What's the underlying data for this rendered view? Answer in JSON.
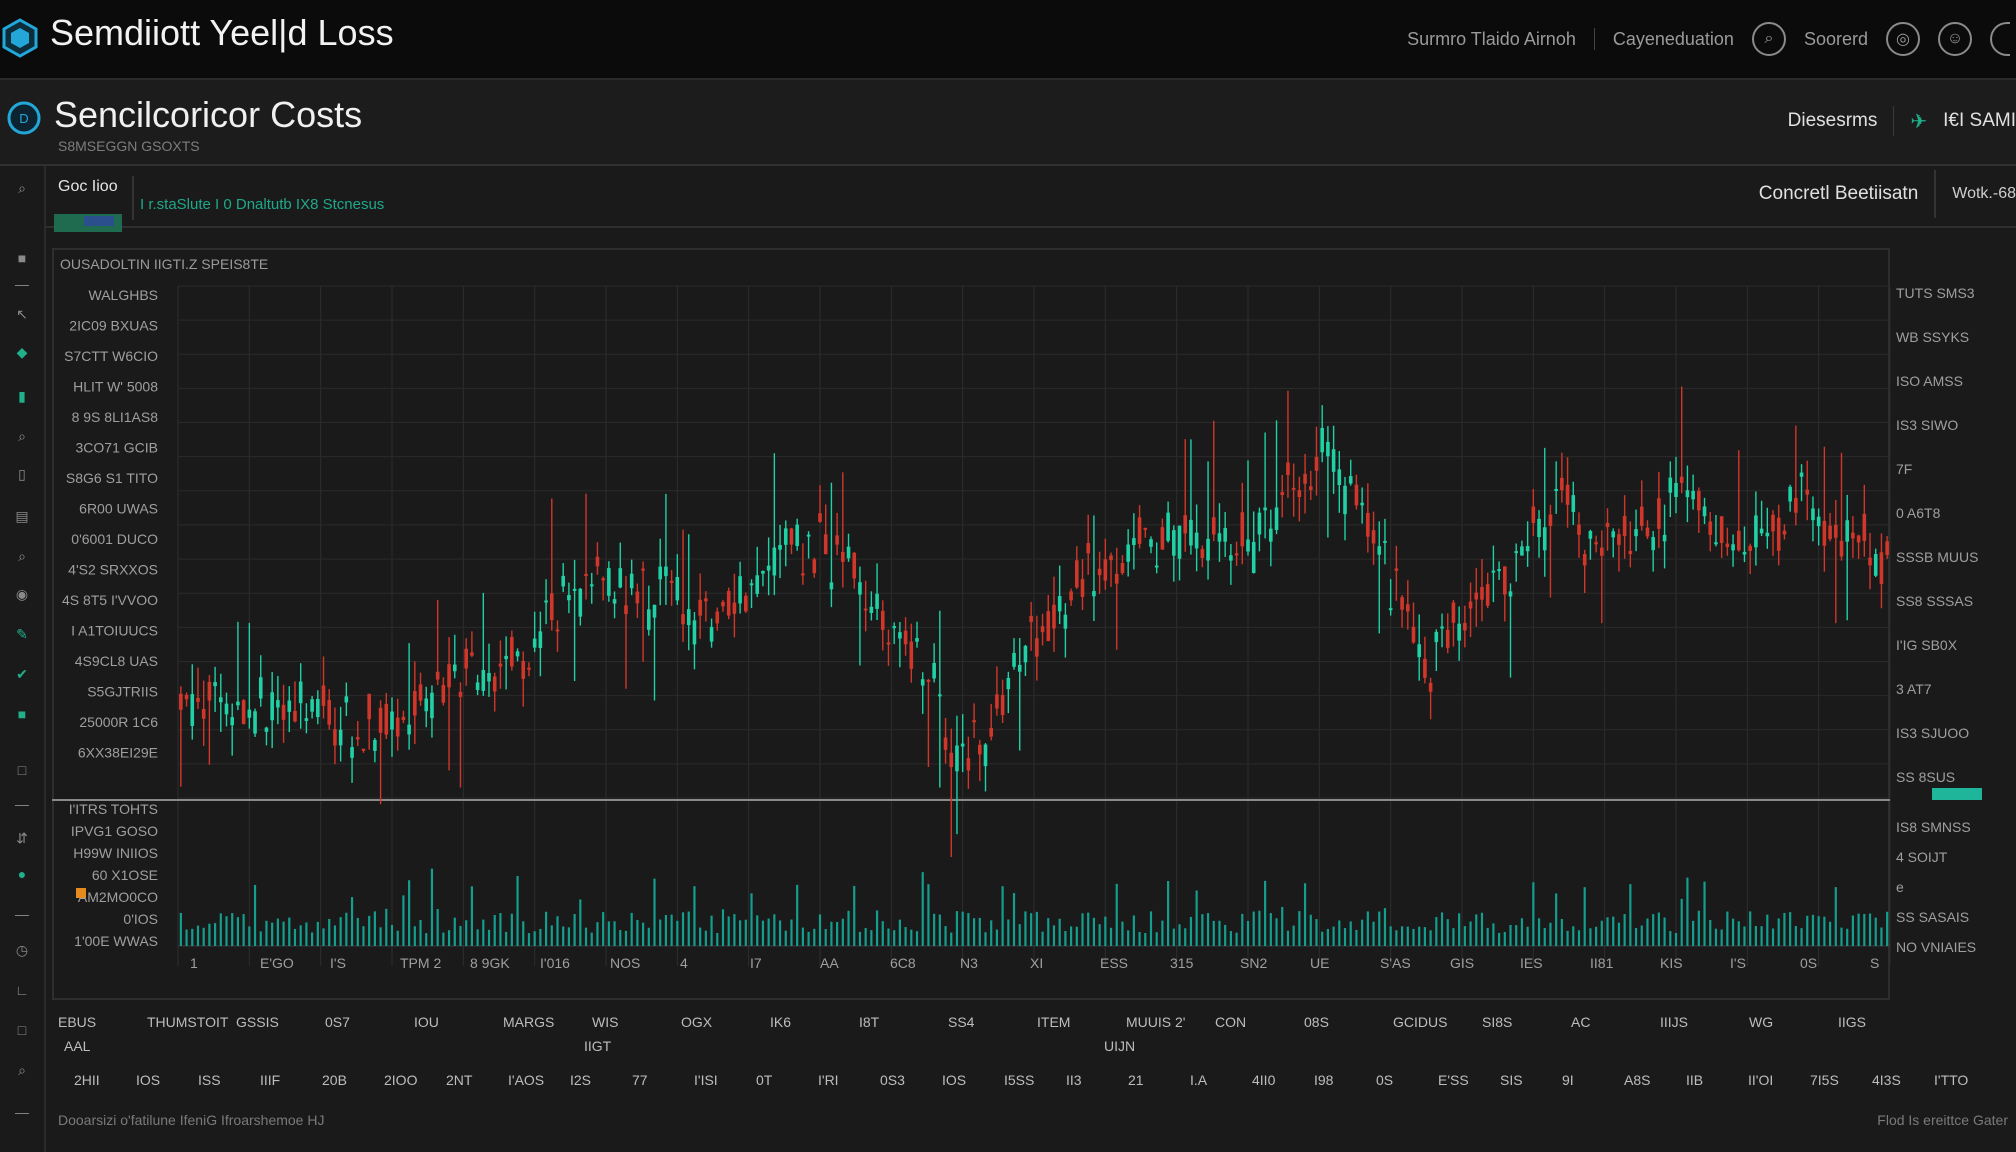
{
  "app": {
    "title": "Semdiiott Yeel|d Loss"
  },
  "top_nav": {
    "item1": "Surmro Tlaido Airnoh",
    "item2": "Cayeneduation",
    "item3": "Soorerd"
  },
  "panel": {
    "title": "Sencilcoricor Costs",
    "caption": "S8MSEGGN GSOXTS",
    "right_label": "Diesesrms",
    "right_value": "I€I SAMI"
  },
  "toolbar": {
    "label": "Goc Iioo",
    "links": "I r.staSlute  I  0 Dnaltutb IX8 Stcnesus",
    "right_label": "Concretl Beetiisatn",
    "right_value": "Wotk.-68"
  },
  "chart_caption": "OUSADOLTIN IIGTI.Z SPEIS8TE",
  "colors": {
    "up": "#1fd1a5",
    "down": "#d0372a",
    "volume": "#139e8e",
    "highlight": "#1fb59a"
  },
  "chart_data": {
    "type": "candlestick",
    "title": "",
    "xlabel": "",
    "ylabel": "",
    "grid": true,
    "ylim_price": [
      0,
      100
    ],
    "ylim_volume": [
      0,
      100
    ],
    "price_path": [
      [
        0,
        20
      ],
      [
        0.07,
        18
      ],
      [
        0.1,
        13
      ],
      [
        0.13,
        16
      ],
      [
        0.17,
        24
      ],
      [
        0.2,
        28
      ],
      [
        0.23,
        41
      ],
      [
        0.25,
        45
      ],
      [
        0.26,
        39
      ],
      [
        0.28,
        40
      ],
      [
        0.31,
        34
      ],
      [
        0.34,
        42
      ],
      [
        0.36,
        50
      ],
      [
        0.38,
        48
      ],
      [
        0.4,
        41
      ],
      [
        0.43,
        30
      ],
      [
        0.44,
        24
      ],
      [
        0.45,
        12
      ],
      [
        0.47,
        10
      ],
      [
        0.48,
        18
      ],
      [
        0.5,
        31
      ],
      [
        0.53,
        43
      ],
      [
        0.55,
        48
      ],
      [
        0.57,
        52
      ],
      [
        0.59,
        50
      ],
      [
        0.61,
        48
      ],
      [
        0.63,
        51
      ],
      [
        0.65,
        62
      ],
      [
        0.67,
        66
      ],
      [
        0.69,
        59
      ],
      [
        0.71,
        43
      ],
      [
        0.72,
        32
      ],
      [
        0.73,
        25
      ],
      [
        0.75,
        38
      ],
      [
        0.78,
        44
      ],
      [
        0.79,
        52
      ],
      [
        0.81,
        57
      ],
      [
        0.83,
        48
      ],
      [
        0.86,
        51
      ],
      [
        0.88,
        61
      ],
      [
        0.9,
        52
      ],
      [
        0.92,
        49
      ],
      [
        0.94,
        56
      ],
      [
        0.95,
        60
      ],
      [
        0.97,
        52
      ],
      [
        1.0,
        47
      ]
    ],
    "left_ticks_price": [
      "WALGHBS",
      "2IC09 BXUAS",
      "S7CTT W6CIO",
      "HLIT W' 5008",
      "8 9S 8LI1AS8",
      "3CO71 GCIB",
      "S8G6 S1 TITO",
      "6R00 UWAS",
      "0'6001 DUCO",
      "4'S2 SRXXOS",
      "4S 8T5 I'VVOO",
      "I A1TOIUUCS",
      "4S9CL8 UAS",
      "S5GJTRIIS",
      "25000R 1C6",
      "6XX38EI29E"
    ],
    "left_ticks_volume": [
      "I'ITRS TOHTS",
      "IPVG1 GOSO",
      "H99W INIIOS",
      "60 X1OSE",
      "AM2MO0CO",
      "0'IOS",
      "1'00E WWAS"
    ],
    "right_ticks_price": [
      "TUTS SMS3",
      "WB  SSYKS",
      "ISO  AMSS",
      "IS3  SIWO",
      "7F",
      "0  A6T8",
      "SSSB  MUUS",
      "SS8  SSSAS",
      "I'IG  SB0X",
      "3  AT7",
      "IS3  SJUOO",
      "SS  8SUS"
    ],
    "right_ticks_volume": [
      "IS8  SMNSS",
      "4  SOIJT",
      "e",
      "SS  SASAIS",
      "NO  VNIAIES"
    ],
    "x_ticks": [
      "1",
      "E'GO",
      "I'S",
      "TPM 2",
      "8 9GK",
      "I'016",
      "NOS",
      "4",
      "I7",
      "AA",
      "6C8",
      "N3",
      "XI",
      "ESS",
      "315",
      "SN2",
      "UE",
      "S'AS",
      "GIS",
      "IES",
      "II81",
      "KIS",
      "I'S",
      "0S",
      "S"
    ],
    "bottom_row1": [
      "EBUS",
      "THUMSTOIT",
      "GSSIS",
      "0S7",
      "IOU",
      "MARGS",
      "WIS",
      "OGX",
      "IK6",
      "I8T",
      "SS4",
      "ITEM",
      "MUUIS 2'",
      "CON",
      "08S",
      "GCIDUS",
      "SI8S",
      "AC",
      "IIIJS",
      "WG",
      "IIGS"
    ],
    "bottom_row2": [
      "AAL",
      "IIGT",
      "UIJN"
    ],
    "bottom_row3": [
      "2HII",
      "IOS",
      "ISS",
      "IIIF",
      "20B",
      "2IOO",
      "2NT",
      "I'AOS",
      "I2S",
      "77",
      "I'ISI",
      "0T",
      "I'RI",
      "0S3",
      "IOS",
      "I5SS",
      "II3",
      "21",
      "I.A",
      "4II0",
      "I98",
      "0S",
      "E'SS",
      "SIS",
      "9I",
      "A8S",
      "IIB",
      "II'OI",
      "7I5S",
      "4I3S",
      "I'TTO"
    ]
  },
  "footer": {
    "left": "Dooarsizi o'fatilune IfeniG Ifroarshemoe HJ",
    "right": "Flod Is ereittce Gater"
  }
}
